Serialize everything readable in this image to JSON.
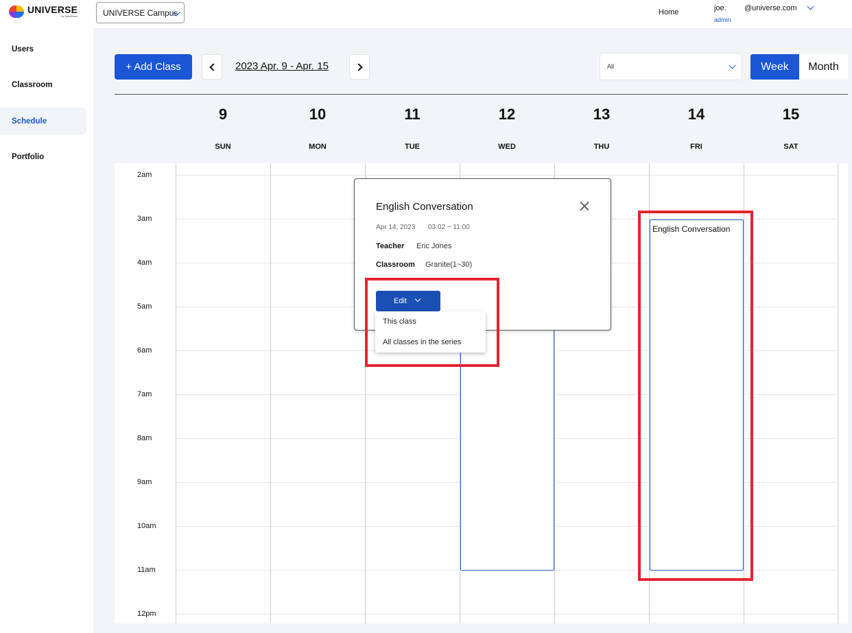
{
  "app": {
    "brand": "UNIVERSE",
    "brand_sub": "by ViewSonic"
  },
  "header": {
    "campus": "UNIVERSE Campus",
    "home": "Home",
    "user_name": "joe.",
    "user_email": "@universe.com",
    "user_role": "admin"
  },
  "sidebar": {
    "items": [
      {
        "label": "Users"
      },
      {
        "label": "Classroom"
      },
      {
        "label": "Schedule"
      },
      {
        "label": "Portfolio"
      }
    ]
  },
  "toolbar": {
    "add_class": "+ Add Class",
    "date_range": "2023 Apr. 9 - Apr. 15",
    "filter_value": "All",
    "week": "Week",
    "month": "Month"
  },
  "days": [
    {
      "num": "9",
      "name": "SUN"
    },
    {
      "num": "10",
      "name": "MON"
    },
    {
      "num": "11",
      "name": "TUE"
    },
    {
      "num": "12",
      "name": "WED"
    },
    {
      "num": "13",
      "name": "THU"
    },
    {
      "num": "14",
      "name": "FRI"
    },
    {
      "num": "15",
      "name": "SAT"
    }
  ],
  "times": [
    "2am",
    "3am",
    "4am",
    "5am",
    "6am",
    "7am",
    "8am",
    "9am",
    "10am",
    "11am",
    "12pm"
  ],
  "events": [
    {
      "title": ""
    },
    {
      "title": "English Conversation"
    }
  ],
  "popup": {
    "title": "English Conversation",
    "date": "Apr 14, 2023",
    "time": "03:02 ~ 11:00",
    "teacher_label": "Teacher",
    "teacher": "Eric Jones",
    "classroom_label": "Classroom",
    "classroom": "Granite(1~30)",
    "edit": "Edit",
    "menu": [
      "This class",
      "All classes in the series"
    ]
  },
  "colors": {
    "primary": "#1a56d6",
    "highlight": "#e3252f"
  }
}
